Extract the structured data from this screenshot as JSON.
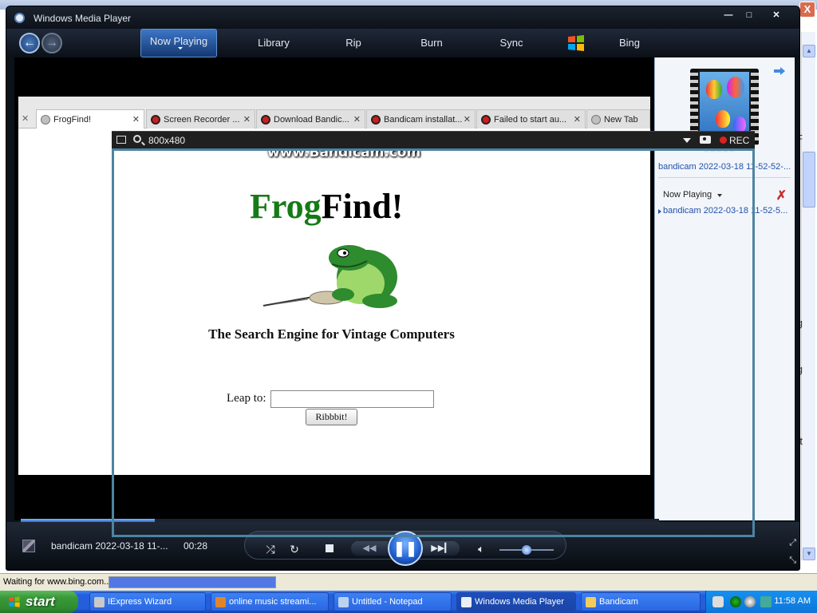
{
  "background_window": {
    "status_text": "Waiting for www.bing.com...",
    "close_label": "X",
    "side_letters": [
      "F",
      "g",
      "g",
      "t"
    ]
  },
  "wmp": {
    "title": "Windows Media Player",
    "controls": {
      "minimize": "—",
      "maximize": "□",
      "close": "✕"
    },
    "nav": {
      "now_playing": "Now Playing",
      "library": "Library",
      "rip": "Rip",
      "burn": "Burn",
      "sync": "Sync",
      "bing": "Bing"
    },
    "browser": {
      "tabs": [
        {
          "label": "FrogFind!",
          "icon": "globe-icon",
          "active": true
        },
        {
          "label": "Screen Recorder ...",
          "icon": "bandicam-icon"
        },
        {
          "label": "Download Bandic...",
          "icon": "bandicam-icon"
        },
        {
          "label": "Bandicam installat...",
          "icon": "bandicam-icon"
        },
        {
          "label": "Failed to start au...",
          "icon": "bandicam-icon"
        },
        {
          "label": "New Tab",
          "icon": "globe-icon"
        }
      ],
      "watermark": "www.Bandicam.com",
      "page": {
        "title_green": "Frog",
        "title_black": "Find!",
        "tagline": "The Search Engine for Vintage Computers",
        "leap_label": "Leap to:",
        "leap_value": "",
        "button": "Ribbbit!"
      }
    },
    "bandicam": {
      "size": "800x480",
      "rec": "REC"
    },
    "list_pane": {
      "track_title": "bandicam 2022-03-18 11-52-52-...",
      "now_playing_dropdown": "Now Playing",
      "items": [
        "bandicam 2022-03-18 11-52-5..."
      ]
    },
    "player": {
      "title": "bandicam 2022-03-18 11-...",
      "time": "00:28",
      "seek_fraction": 0.21,
      "volume_fraction": 0.5
    }
  },
  "taskbar": {
    "start": "start",
    "tasks": [
      {
        "label": "IExpress Wizard",
        "icon": "iexpress-icon",
        "color": "#c9c9c9"
      },
      {
        "label": "online music streami...",
        "icon": "firefox-icon",
        "color": "#e0862a"
      },
      {
        "label": "Untitled - Notepad",
        "icon": "notepad-icon",
        "color": "#bcd3f0"
      },
      {
        "label": "Windows Media Player",
        "icon": "wmp-icon",
        "color": "#e8eef6"
      },
      {
        "label": "Bandicam",
        "icon": "folder-icon",
        "color": "#f2cd5c"
      }
    ],
    "clock": "11:58 AM"
  }
}
